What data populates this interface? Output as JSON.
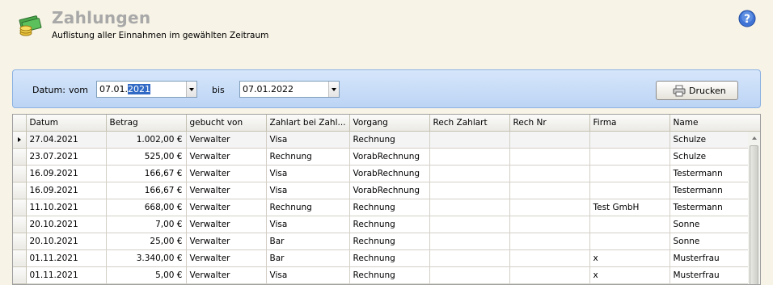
{
  "header": {
    "title": "Zahlungen",
    "subtitle": "Auflistung aller Einnahmen im gewählten Zeitraum"
  },
  "filter": {
    "date_label": "Datum:",
    "from_label": "vom",
    "from_value_prefix": "07.01.",
    "from_value_selected": "2021",
    "to_label": "bis",
    "to_value": "07.01.2022",
    "print_label": "Drucken"
  },
  "grid": {
    "columns": [
      "Datum",
      "Betrag",
      "gebucht von",
      "Zahlart bei Zahl...",
      "Vorgang",
      "Rech Zahlart",
      "Rech Nr",
      "Firma",
      "Name"
    ],
    "rows": [
      [
        "27.04.2021",
        "1.002,00 €",
        "Verwalter",
        "Visa",
        "Rechnung",
        "",
        "",
        "",
        "Schulze"
      ],
      [
        "23.07.2021",
        "525,00 €",
        "Verwalter",
        "Rechnung",
        "VorabRechnung",
        "",
        "",
        "",
        "Schulze"
      ],
      [
        "16.09.2021",
        "166,67 €",
        "Verwalter",
        "Visa",
        "VorabRechnung",
        "",
        "",
        "",
        "Testermann"
      ],
      [
        "16.09.2021",
        "166,67 €",
        "Verwalter",
        "Visa",
        "VorabRechnung",
        "",
        "",
        "",
        "Testermann"
      ],
      [
        "11.10.2021",
        "668,00 €",
        "Verwalter",
        "Rechnung",
        "Rechnung",
        "",
        "",
        "Test GmbH",
        "Testermann"
      ],
      [
        "20.10.2021",
        "7,00 €",
        "Verwalter",
        "Visa",
        "Rechnung",
        "",
        "",
        "",
        "Sonne"
      ],
      [
        "20.10.2021",
        "25,00 €",
        "Verwalter",
        "Bar",
        "Rechnung",
        "",
        "",
        "",
        "Sonne"
      ],
      [
        "01.11.2021",
        "3.340,00 €",
        "Verwalter",
        "Bar",
        "Rechnung",
        "",
        "",
        "x",
        "Musterfrau"
      ],
      [
        "01.11.2021",
        "5,00 €",
        "Verwalter",
        "Visa",
        "Rechnung",
        "",
        "",
        "x",
        "Musterfrau"
      ]
    ]
  },
  "icons": {
    "app": "money-coins-icon",
    "help": "help-icon",
    "print": "printer-icon"
  },
  "colors": {
    "panel_border": "#8db2e3",
    "selection": "#316ac5"
  }
}
